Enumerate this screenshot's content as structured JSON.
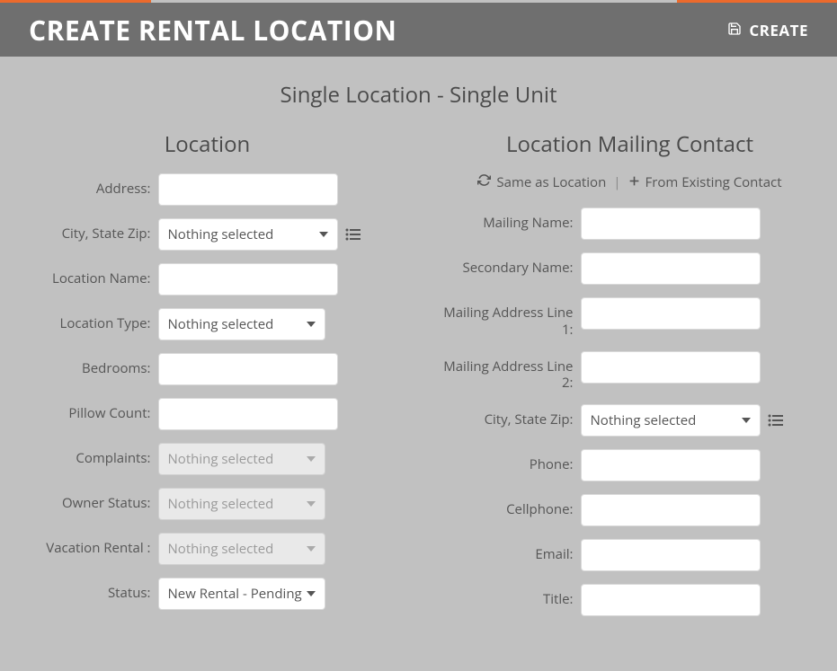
{
  "header": {
    "title": "CREATE RENTAL LOCATION",
    "create_label": "CREATE"
  },
  "subtitle": "Single Location - Single Unit",
  "location": {
    "heading": "Location",
    "fields": {
      "address_label": "Address:",
      "city_label": "City, State Zip:",
      "city_value": "Nothing selected",
      "name_label": "Location Name:",
      "type_label": "Location Type:",
      "type_value": "Nothing selected",
      "bedrooms_label": "Bedrooms:",
      "pillow_label": "Pillow Count:",
      "complaints_label": "Complaints:",
      "complaints_value": "Nothing selected",
      "owner_status_label": "Owner Status:",
      "owner_status_value": "Nothing selected",
      "vacation_label": "Vacation Rental :",
      "vacation_value": "Nothing selected",
      "status_label": "Status:",
      "status_value": "New Rental - Pending"
    }
  },
  "contact": {
    "heading": "Location Mailing Contact",
    "same_as_label": "Same as Location",
    "from_existing_label": "From Existing Contact",
    "divider": "|",
    "fields": {
      "mailing_name_label": "Mailing Name:",
      "secondary_name_label": "Secondary Name:",
      "addr1_label": "Mailing Address Line 1:",
      "addr2_label": "Mailing Address Line 2:",
      "city_label": "City, State Zip:",
      "city_value": "Nothing selected",
      "phone_label": "Phone:",
      "cell_label": "Cellphone:",
      "email_label": "Email:",
      "title_label": "Title:"
    }
  }
}
